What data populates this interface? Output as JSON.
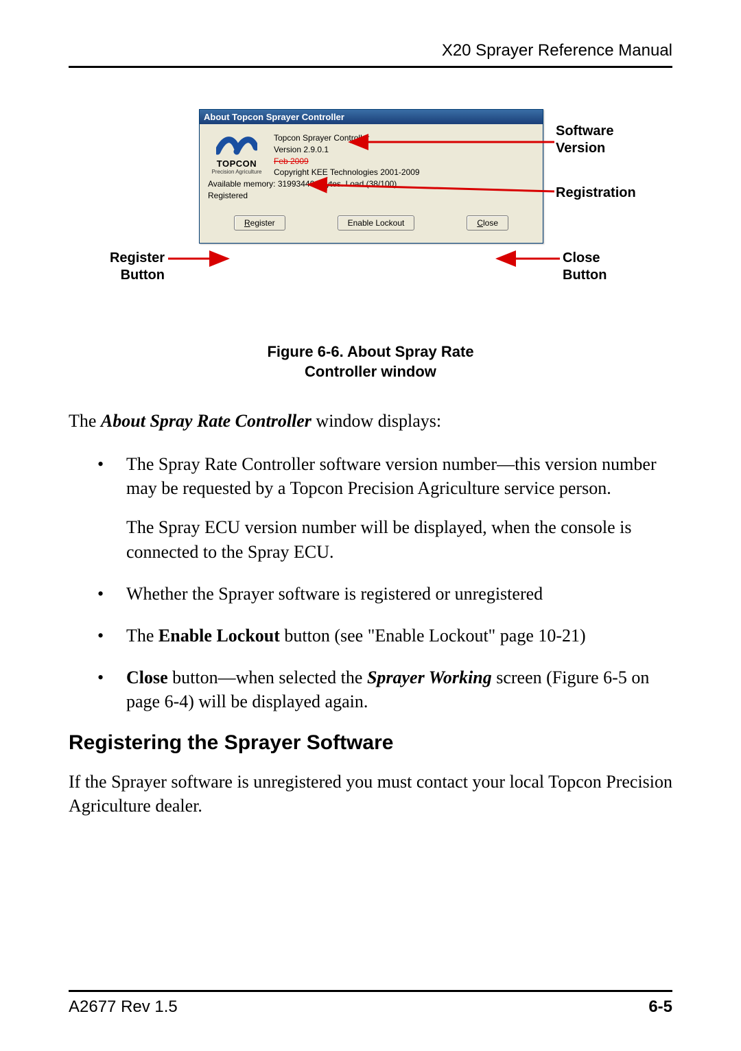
{
  "header": {
    "title": "X20 Sprayer Reference Manual"
  },
  "about_window": {
    "title": "About Topcon Sprayer Controller",
    "logo_name": "TOPCON",
    "logo_sub": "Precision Agriculture",
    "line_product": "Topcon Sprayer Controller",
    "line_version_prefix": "Version 2.9.0.1",
    "line_version_struck": "Feb 2009",
    "line_copyright": "Copyright KEE Technologies 2001-2009",
    "line_memory": "Available memory: 319934464 bytes. Load (38/100)",
    "line_registration": "Registered",
    "btn_register_u": "R",
    "btn_register_rest": "egister",
    "btn_lockout": "Enable Lockout",
    "btn_close_u": "C",
    "btn_close_rest": "lose"
  },
  "callouts": {
    "software_version_l1": "Software",
    "software_version_l2": "Version",
    "registration": "Registration",
    "register_button_l1": "Register",
    "register_button_l2": "Button",
    "close_button_l1": "Close",
    "close_button_l2": "Button",
    "arrow_color": "#d80000"
  },
  "figure_caption_l1": "Figure 6-6. About Spray Rate",
  "figure_caption_l2": "Controller window",
  "body": {
    "intro_pre": "The ",
    "intro_em": "About Spray Rate Controller",
    "intro_post": " window displays:",
    "b1p1": "The Spray Rate Controller software version number—this version number may be requested by a Topcon Precision Agriculture service person.",
    "b1p2": "The Spray ECU version number will be displayed, when the console is connected to the Spray ECU.",
    "b2": "Whether the Sprayer software is registered or unregistered",
    "b3_pre": "The ",
    "b3_bold": "Enable Lockout",
    "b3_post": " button (see \"Enable Lockout\" page 10-21)",
    "b4_bold": "Close",
    "b4_mid": " button—when selected the ",
    "b4_em": "Sprayer Working",
    "b4_post": " screen (Figure 6-5 on page 6-4) will be displayed again."
  },
  "section_heading": "Registering the Sprayer Software",
  "section_para": "If the Sprayer software is unregistered you must contact your local Topcon Precision Agriculture dealer.",
  "footer": {
    "doc_rev": "A2677 Rev 1.5",
    "page_no": "6-5"
  }
}
